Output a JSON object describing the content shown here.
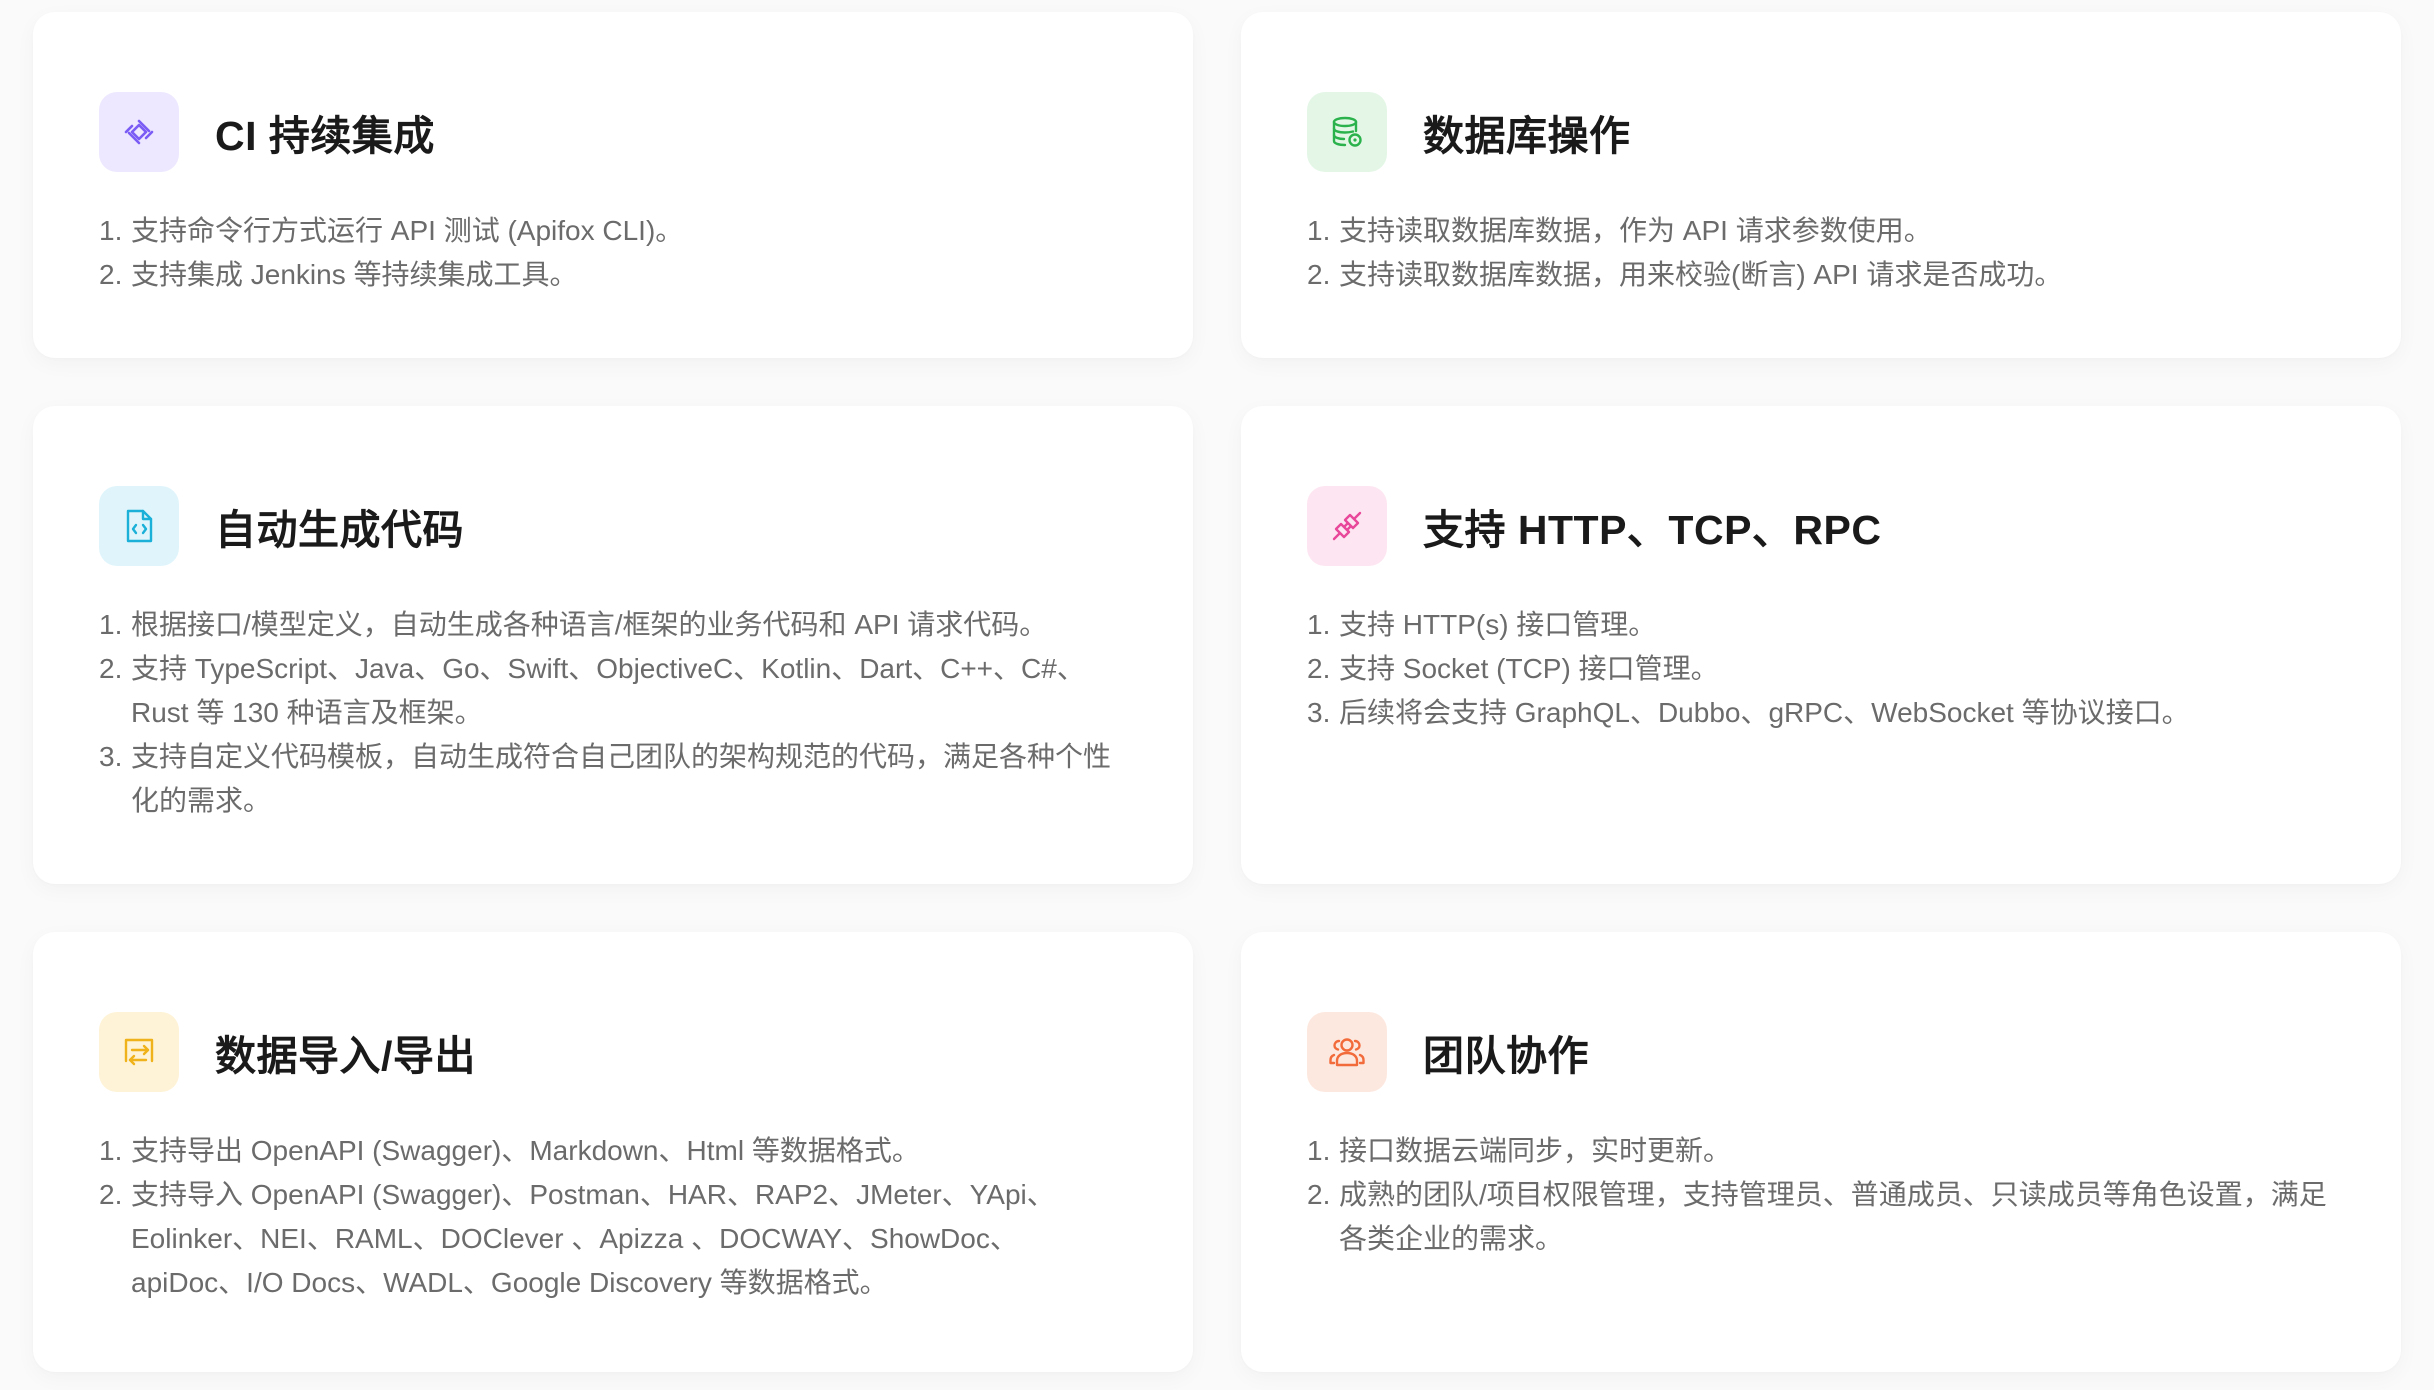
{
  "cards": [
    {
      "title": "CI 持续集成",
      "icon": "ci-integration-icon",
      "accent": "#7b5cf5",
      "icon_bg": "#ede8ff",
      "items": [
        {
          "num": "1.",
          "text": "支持命令行方式运行 API 测试 (Apifox CLI)。"
        },
        {
          "num": "2.",
          "text": "支持集成 Jenkins 等持续集成工具。"
        }
      ]
    },
    {
      "title": "数据库操作",
      "icon": "database-icon",
      "accent": "#2bb24c",
      "icon_bg": "#e4f7e7",
      "items": [
        {
          "num": "1.",
          "text": "支持读取数据库数据，作为 API 请求参数使用。"
        },
        {
          "num": "2.",
          "text": "支持读取数据库数据，用来校验(断言) API 请求是否成功。"
        }
      ]
    },
    {
      "title": "自动生成代码",
      "icon": "code-file-icon",
      "accent": "#1ab0d8",
      "icon_bg": "#e0f5fb",
      "items": [
        {
          "num": "1.",
          "text": "根据接口/模型定义，自动生成各种语言/框架的业务代码和 API 请求代码。"
        },
        {
          "num": "2.",
          "text": "支持 TypeScript、Java、Go、Swift、ObjectiveC、Kotlin、Dart、C++、C#、Rust 等 130 种语言及框架。"
        },
        {
          "num": "3.",
          "text": "支持自定义代码模板，自动生成符合自己团队的架构规范的代码，满足各种个性化的需求。"
        }
      ]
    },
    {
      "title": "支持 HTTP、TCP、RPC",
      "icon": "plug-connection-icon",
      "accent": "#e8479a",
      "icon_bg": "#fde6f1",
      "items": [
        {
          "num": "1.",
          "text": "支持 HTTP(s) 接口管理。"
        },
        {
          "num": "2.",
          "text": "支持 Socket (TCP) 接口管理。"
        },
        {
          "num": "3.",
          "text": "后续将会支持 GraphQL、Dubbo、gRPC、WebSocket 等协议接口。"
        }
      ]
    },
    {
      "title": "数据导入/导出",
      "icon": "import-export-icon",
      "accent": "#f0b21a",
      "icon_bg": "#fef3d6",
      "items": [
        {
          "num": "1.",
          "text": "支持导出 OpenAPI (Swagger)、Markdown、Html 等数据格式。"
        },
        {
          "num": "2.",
          "text": "支持导入 OpenAPI (Swagger)、Postman、HAR、RAP2、JMeter、YApi、Eolinker、NEI、RAML、DOClever 、Apizza 、DOCWAY、ShowDoc、apiDoc、I/O Docs、WADL、Google Discovery 等数据格式。"
        }
      ]
    },
    {
      "title": "团队协作",
      "icon": "team-users-icon",
      "accent": "#f26b3a",
      "icon_bg": "#fde8df",
      "items": [
        {
          "num": "1.",
          "text": "接口数据云端同步，实时更新。"
        },
        {
          "num": "2.",
          "text": "成熟的团队/项目权限管理，支持管理员、普通成员、只读成员等角色设置，满足各类企业的需求。"
        }
      ]
    }
  ]
}
